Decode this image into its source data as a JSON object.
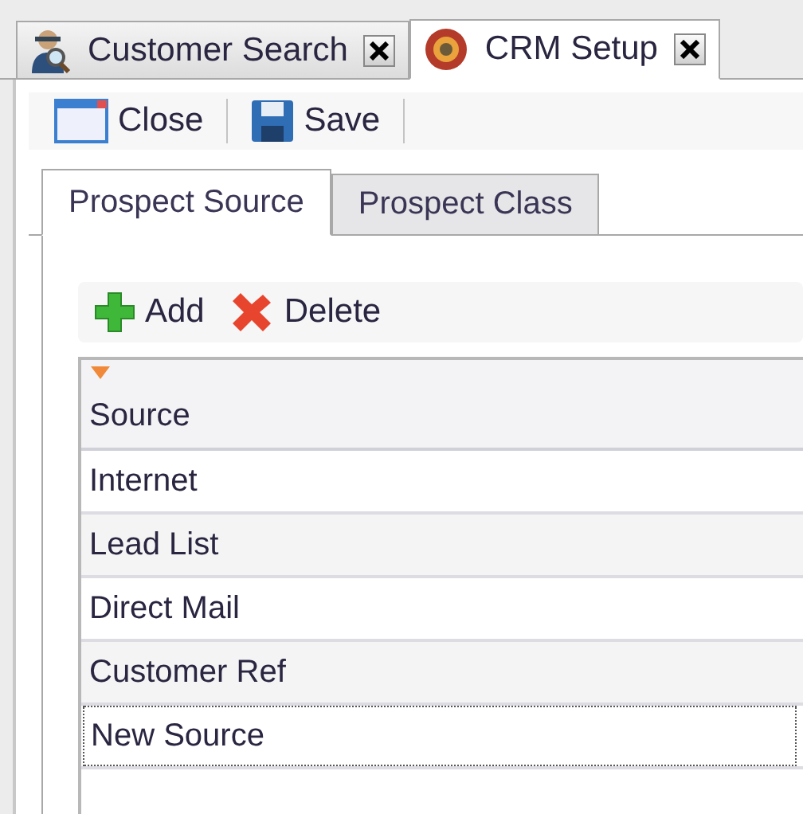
{
  "document_tabs": [
    {
      "label": "Customer Search",
      "kind": "search",
      "selected": false
    },
    {
      "label": "CRM Setup",
      "kind": "setup",
      "selected": true
    }
  ],
  "toolbar": [
    {
      "label": "Close",
      "kind": "close"
    },
    {
      "label": "Save",
      "kind": "save"
    }
  ],
  "section_tabs": [
    {
      "label": "Prospect Source",
      "selected": true
    },
    {
      "label": "Prospect Class",
      "selected": false
    }
  ],
  "grid_toolbar": [
    {
      "label": "Add",
      "kind": "add"
    },
    {
      "label": "Delete",
      "kind": "delete"
    }
  ],
  "grid": {
    "column": "Source",
    "rows": [
      {
        "value": "Internet",
        "editing": false
      },
      {
        "value": "Lead List",
        "editing": false
      },
      {
        "value": "Direct Mail",
        "editing": false
      },
      {
        "value": "Customer Ref",
        "editing": false
      },
      {
        "value": "New Source",
        "editing": true
      }
    ]
  }
}
